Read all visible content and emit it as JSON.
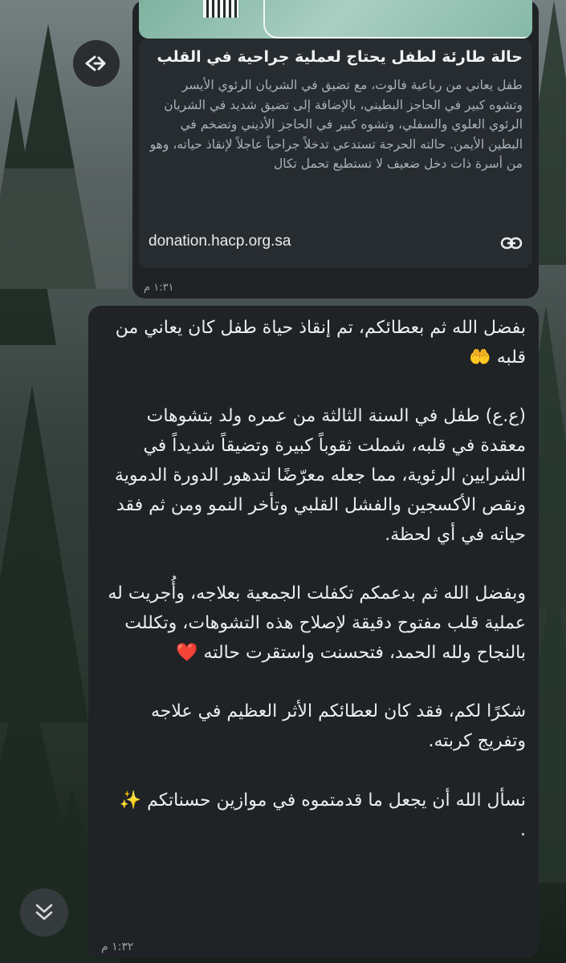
{
  "link_message": {
    "title": "حالة طارئة لطفل يحتاج لعملية جراحية في القلب",
    "description": "طفل يعاني من رباعية فالوت، مع تضيق في الشريان الرئوي الأيسر وتشوه كبير في الحاجز البطيني، بالإضافة إلى تضيق شديد في الشريان الرئوي العلوي والسفلي، وتشوه كبير في الحاجز الأذيني وتضخم في البطين الأيمن. حالته الحرجة تستدعي تدخلاً جراحياً عاجلاً لإنقاذ حياته، وهو من أسرة ذات دخل ضعيف لا تستطيع تحمل تكال",
    "domain": "donation.hacp.org.sa",
    "time": "١:٣١ م"
  },
  "text_message": {
    "body": "بفضل الله ثم بعطائكم، تم إنقاذ حياة طفل كان يعاني من قلبه 🤲\n\n(ع.ع) طفل في السنة الثالثة من عمره ولد بتشوهات معقدة في قلبه، شملت ثقوباً كبيرة وتضيقاً شديداً في الشرايين الرئوية، مما جعله معرّضًا لتدهور الدورة الدموية ونقص الأكسجين والفشل القلبي وتأخر النمو ومن ثم فقد حياته في أي لحظة.\n\nوبفضل الله ثم بدعمكم تكفلت الجمعية بعلاجه، وأُجريت له عملية قلب مفتوح دقيقة لإصلاح هذه التشوهات، وتكللت بالنجاح ولله الحمد، فتحسنت واستقرت حالته ❤️\n\nشكرًا لكم، فقد كان لعطائكم الأثر العظيم في علاجه وتفريج كربته.\n\nنسأل الله أن يجعل ما قدمتموه في موازين حسناتكم ✨\n.",
    "time": "١:٣٢ م"
  },
  "icons": {
    "forward": "forward-arrow-icon",
    "link": "link-icon",
    "scroll_down": "double-chevron-down-icon"
  },
  "colors": {
    "bubble_bg": "#1f2326",
    "card_bg": "#272c30",
    "text": "#e9edef",
    "muted": "#aab2b8"
  }
}
